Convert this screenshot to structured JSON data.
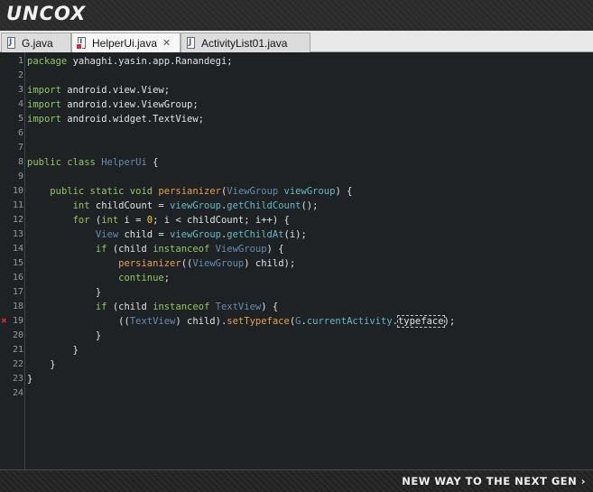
{
  "banner": {
    "brand": "UNCOX"
  },
  "tabs": [
    {
      "label": "G.java",
      "active": false,
      "error": false
    },
    {
      "label": "HelperUi.java",
      "active": true,
      "error": true,
      "close": "✕"
    },
    {
      "label": "ActivityList01.java",
      "active": false,
      "error": false
    }
  ],
  "editor": {
    "line_numbers": [
      "1",
      "2",
      "3",
      "4",
      "5",
      "6",
      "7",
      "8",
      "9",
      "10",
      "11",
      "12",
      "13",
      "14",
      "15",
      "16",
      "17",
      "18",
      "19",
      "20",
      "21",
      "22",
      "23",
      "24"
    ],
    "error_line": "19",
    "code_lines": [
      [
        [
          "kw",
          "package"
        ],
        [
          "t",
          " yahaghi.yasin.app.Ranandegi;"
        ]
      ],
      [],
      [
        [
          "kw",
          "import"
        ],
        [
          "t",
          " android.view.View;"
        ]
      ],
      [
        [
          "kw",
          "import"
        ],
        [
          "t",
          " android.view.ViewGroup;"
        ]
      ],
      [
        [
          "kw",
          "import"
        ],
        [
          "t",
          " android.widget.TextView;"
        ]
      ],
      [],
      [],
      [
        [
          "kw",
          "public class"
        ],
        [
          "t",
          " "
        ],
        [
          "ty",
          "HelperUi"
        ],
        [
          "t",
          " {"
        ]
      ],
      [],
      [
        [
          "t",
          "    "
        ],
        [
          "kw",
          "public static void"
        ],
        [
          "t",
          " "
        ],
        [
          "fn",
          "persianizer"
        ],
        [
          "t",
          "("
        ],
        [
          "ty",
          "ViewGroup"
        ],
        [
          "t",
          " "
        ],
        [
          "ml",
          "viewGroup"
        ],
        [
          "t",
          ") {"
        ]
      ],
      [
        [
          "t",
          "        "
        ],
        [
          "kw",
          "int"
        ],
        [
          "t",
          " childCount = "
        ],
        [
          "ml",
          "viewGroup"
        ],
        [
          "t",
          "."
        ],
        [
          "ml",
          "getChildCount"
        ],
        [
          "t",
          "();"
        ]
      ],
      [
        [
          "t",
          "        "
        ],
        [
          "kw",
          "for"
        ],
        [
          "t",
          " ("
        ],
        [
          "kw",
          "int"
        ],
        [
          "t",
          " i = "
        ],
        [
          "num",
          "0"
        ],
        [
          "t",
          "; i < childCount; i++) {"
        ]
      ],
      [
        [
          "t",
          "            "
        ],
        [
          "ty",
          "View"
        ],
        [
          "t",
          " child = "
        ],
        [
          "ml",
          "viewGroup"
        ],
        [
          "t",
          "."
        ],
        [
          "ml",
          "getChildAt"
        ],
        [
          "t",
          "(i);"
        ]
      ],
      [
        [
          "t",
          "            "
        ],
        [
          "kw",
          "if"
        ],
        [
          "t",
          " (child "
        ],
        [
          "kw",
          "instanceof"
        ],
        [
          "t",
          " "
        ],
        [
          "ty",
          "ViewGroup"
        ],
        [
          "t",
          ") {"
        ]
      ],
      [
        [
          "t",
          "                "
        ],
        [
          "fn",
          "persianizer"
        ],
        [
          "t",
          "(("
        ],
        [
          "ty",
          "ViewGroup"
        ],
        [
          "t",
          ") child);"
        ]
      ],
      [
        [
          "t",
          "                "
        ],
        [
          "kw",
          "continue"
        ],
        [
          "t",
          ";"
        ]
      ],
      [
        [
          "t",
          "            }"
        ]
      ],
      [
        [
          "t",
          "            "
        ],
        [
          "kw",
          "if"
        ],
        [
          "t",
          " (child "
        ],
        [
          "kw",
          "instanceof"
        ],
        [
          "t",
          " "
        ],
        [
          "ty",
          "TextView"
        ],
        [
          "t",
          ") {"
        ]
      ],
      [
        [
          "t",
          "                (("
        ],
        [
          "ty",
          "TextView"
        ],
        [
          "t",
          ") child)."
        ],
        [
          "fn",
          "setTypeface"
        ],
        [
          "t",
          "("
        ],
        [
          "ty",
          "G"
        ],
        [
          "t",
          "."
        ],
        [
          "ml",
          "currentActivity"
        ],
        [
          "t",
          "."
        ],
        [
          "hl",
          "typeface"
        ],
        [
          "t",
          ");"
        ]
      ],
      [
        [
          "t",
          "            }"
        ]
      ],
      [
        [
          "t",
          "        }"
        ]
      ],
      [
        [
          "t",
          "    }"
        ]
      ],
      [
        [
          "t",
          "}"
        ]
      ],
      []
    ]
  },
  "footer": {
    "tagline": "NEW WAY TO THE NEXT GEN ›"
  },
  "colors": {
    "keyword": "#93c763",
    "type": "#678cb1",
    "method": "#e8a24a",
    "member": "#67b8c8",
    "number": "#ffcd22",
    "text": "#dfe4e6",
    "background": "#1e2224"
  }
}
